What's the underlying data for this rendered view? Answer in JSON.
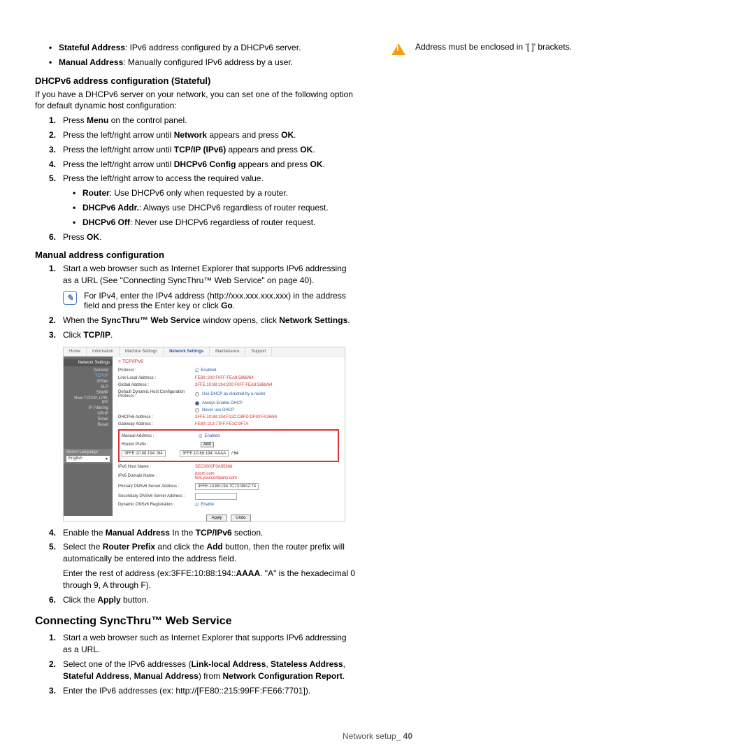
{
  "col1": {
    "defs": [
      {
        "term": "Stateful Address",
        "desc": ": IPv6 address configured by a DHCPv6 server."
      },
      {
        "term": "Manual Address",
        "desc": ": Manually configured IPv6 address by a user."
      }
    ],
    "h_stateful": "DHCPv6 address configuration (Stateful)",
    "p_stateful": "If you have a DHCPv6 server on your network, you can set one of the following option for default dynamic host configuration:",
    "stateful_steps": [
      {
        "n": "1.",
        "pre": "Press ",
        "b": "Menu",
        "post": " on the control panel."
      },
      {
        "n": "2.",
        "pre": "Press the left/right arrow until ",
        "b": "Network",
        "post": " appears and press ",
        "b2": "OK",
        "post2": "."
      },
      {
        "n": "3.",
        "pre": "Press the left/right arrow until ",
        "b": "TCP/IP (IPv6)",
        "post": " appears and press ",
        "b2": "OK",
        "post2": "."
      },
      {
        "n": "4.",
        "pre": "Press the left/right arrow until ",
        "b": "DHCPv6 Config",
        "post": " appears and press ",
        "b2": "OK",
        "post2": "."
      },
      {
        "n": "5.",
        "pre": "Press the left/right arrow to access the required value.",
        "sub": [
          {
            "b": "Router",
            "t": ": Use DHCPv6 only when requested by a router."
          },
          {
            "b": "DHCPv6 Addr.",
            "t": ": Always use DHCPv6 regardless of router request."
          },
          {
            "b": "DHCPv6 Off",
            "t": ": Never use DHCPv6 regardless of router request."
          }
        ]
      },
      {
        "n": "6.",
        "pre": "Press ",
        "b": "OK",
        "post": "."
      }
    ],
    "h_manual": "Manual address configuration",
    "manual1": {
      "n": "1.",
      "t": "Start a web browser such as Internet Explorer that supports IPv6 addressing as a URL (See \"Connecting SyncThru™ Web Service\" on page 40)."
    },
    "note_ipv4": "For IPv4, enter the IPv4 address (http://xxx.xxx.xxx.xxx) in the address field and press the Enter key or click ",
    "note_ipv4_b": "Go",
    "manual2": {
      "n": "2.",
      "pre": "When the ",
      "b": "SyncThru™ Web Service",
      "post": " window opens, click ",
      "b2": "Network Settings",
      "post2": "."
    },
    "manual3": {
      "n": "3.",
      "pre": "Click ",
      "b": "TCP/IP",
      "post": "."
    },
    "manual4": {
      "n": "4.",
      "pre": "Enable the ",
      "b": "Manual Address",
      "post": " In the ",
      "b2": "TCP/IPv6",
      "post2": " section."
    },
    "manual5": {
      "n": "5.",
      "pre": "Select the ",
      "b": "Router Prefix",
      "post": " and click the ",
      "b2": "Add",
      "post2": " button, then the router prefix will automatically be entered into the address field."
    },
    "manual5b": {
      "pre": "Enter the rest of address (ex:3FFE:10:88:194::",
      "b": "AAAA",
      "post": ". \"A\" is the hexadecimal 0 through 9, A through F)."
    },
    "manual6": {
      "n": "6.",
      "pre": "Click the ",
      "b": "Apply",
      "post": " button."
    },
    "h_connect": "Connecting SyncThru™ Web Service",
    "conn1": {
      "n": "1.",
      "t": "Start a web browser such as Internet Explorer that supports IPv6 addressing as a URL."
    },
    "conn2": {
      "n": "2.",
      "pre": "Select one of the IPv6 addresses (",
      "b": "Link-local Address",
      "post": ", ",
      "b2": "Stateless Address",
      "post2": ", ",
      "b3": "Stateful Address",
      "post3": ", ",
      "b4": "Manual Address",
      "post4": ") from ",
      "b5": "Network Configuration Report",
      "post5": "."
    },
    "conn3": {
      "n": "3.",
      "t": "Enter the IPv6 addresses (ex: http://[FE80::215:99FF:FE66:7701])."
    }
  },
  "col2": {
    "warn": "Address must be enclosed in '[ ]' brackets."
  },
  "ss": {
    "tabs": [
      "Home",
      "Information",
      "Machine Settings",
      "Network Settings",
      "Maintenance",
      "Support"
    ],
    "sidehdr": "Network Settings",
    "side": [
      "General",
      "TCP/IP",
      "IPSec",
      "SLP",
      "SNMP",
      "Raw TCP/IP, LPR, IPP",
      "IP Filtering",
      "UPnP",
      "Telnet",
      "Reset"
    ],
    "lang_label": "Select Language",
    "lang": "English",
    "crumb": "> TCP/IPv6",
    "rows": {
      "proto": "Protocol :",
      "proto_v": "Enabled",
      "lla": "Link-Local Address :",
      "lla_v": "FE80::200:F0FF:FEA9:5868/64",
      "ga": "Global Address :",
      "ga_v": "3FFE:10:88:194:200:F0FF:FEA9:5868/64",
      "ddhc": "Default Dynamic Host Configuration Protocol :",
      "r1": "Use DHCP as directed by a router",
      "r2": "Always Enable DHCP",
      "r3": "Never use DHCP",
      "dhcpa": "DHCPv6 Address :",
      "dhcpa_v": "3FFE:10:88:194:F12C:D8FD:DF93:FA26/64",
      "gw": "Gateway Address :",
      "gw_v": "FE80::213:77FF:FE1C:9F7A",
      "ma": "Manual Address :",
      "ma_v": "Enabled",
      "rp": "Router Prefix :",
      "rp_in": "3FFE:10:88:194::/64",
      "add": "Add",
      "rp_in2": "3FFE:10:88:194::AAAA",
      "rp_sfx": "/ 64",
      "host": "IPv6 Host Name :",
      "host_v": "SEC0000F0A95868",
      "dom": "IPv6 Domain Name :",
      "dom_v": "dpctrl.com\ntest.yourcompany.com",
      "pdns": "Primary DNSv6 Server Address :",
      "pdns_v": "3FFE:10:88:194:7C73:98A2:74",
      "sdns": "Secondary DNSv6 Server Address :",
      "ddns": "Dynamic DNSv6 Registration :",
      "ddns_v": "Enable",
      "apply": "Apply",
      "undo": "Undo"
    }
  },
  "footer": {
    "label": "Network setup_",
    "page": "40"
  }
}
